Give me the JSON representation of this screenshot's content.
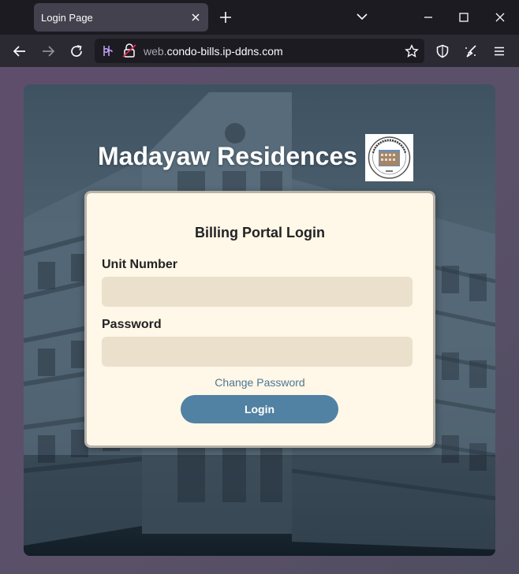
{
  "browser": {
    "tab": {
      "title": "Login Page",
      "close_icon": "close-icon"
    },
    "new_tab_icon": "plus-icon",
    "tab_list_icon": "chevron-down-icon",
    "window_controls": [
      "minimize-icon",
      "maximize-icon",
      "close-icon"
    ],
    "nav": {
      "back_icon": "arrow-left-icon",
      "forward_icon": "arrow-right-icon",
      "reload_icon": "reload-icon"
    },
    "url": {
      "prefix": "web.",
      "domain": "condo-bills.ip-ddns.com"
    },
    "toolbar_icons": [
      "star-icon",
      "shield-icon",
      "cleaner-icon",
      "menu-icon"
    ]
  },
  "page": {
    "site_title": "Madayaw Residences",
    "logo_icon": "residence-seal-logo",
    "login": {
      "heading": "Billing Portal Login",
      "unit_label": "Unit Number",
      "unit_value": "",
      "password_label": "Password",
      "password_value": "",
      "change_password_link": "Change Password",
      "login_button": "Login"
    }
  },
  "colors": {
    "accent": "#5181a3",
    "link": "#4b7894",
    "card_background": "#fff7e8",
    "input_background": "#ebe0cc",
    "chrome_dark": "#1c1b22"
  }
}
